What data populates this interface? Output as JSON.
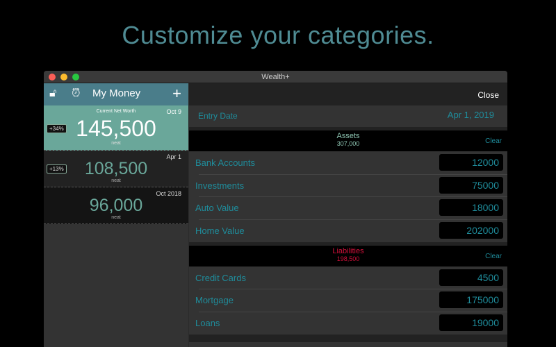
{
  "headline": "Customize your categories.",
  "window": {
    "title": "Wealth+"
  },
  "sidebar": {
    "title": "My Money",
    "entries": [
      {
        "label": "Current Net Worth",
        "date": "Oct 9",
        "value": "145,500",
        "sub": "neat",
        "badge": "+34%"
      },
      {
        "date": "Apr 1",
        "value": "108,500",
        "sub": "neat",
        "badge": "+13%"
      },
      {
        "date": "Oct 2018",
        "value": "96,000",
        "sub": "neat"
      }
    ]
  },
  "main": {
    "close": "Close",
    "entry_date_label": "Entry Date",
    "entry_date": "Apr 1, 2019",
    "assets": {
      "title": "Assets",
      "total": "307,000",
      "clear": "Clear",
      "rows": [
        {
          "label": "Bank Accounts",
          "value": "12000"
        },
        {
          "label": "Investments",
          "value": "75000"
        },
        {
          "label": "Auto Value",
          "value": "18000"
        },
        {
          "label": "Home Value",
          "value": "202000"
        }
      ]
    },
    "liabilities": {
      "title": "Liabilities",
      "total": "198,500",
      "clear": "Clear",
      "rows": [
        {
          "label": "Credit Cards",
          "value": "4500"
        },
        {
          "label": "Mortgage",
          "value": "175000"
        },
        {
          "label": "Loans",
          "value": "19000"
        }
      ]
    }
  },
  "colors": {
    "accent": "#1f8c9b",
    "liability": "#d0103a",
    "asset": "#8fc7b4"
  }
}
